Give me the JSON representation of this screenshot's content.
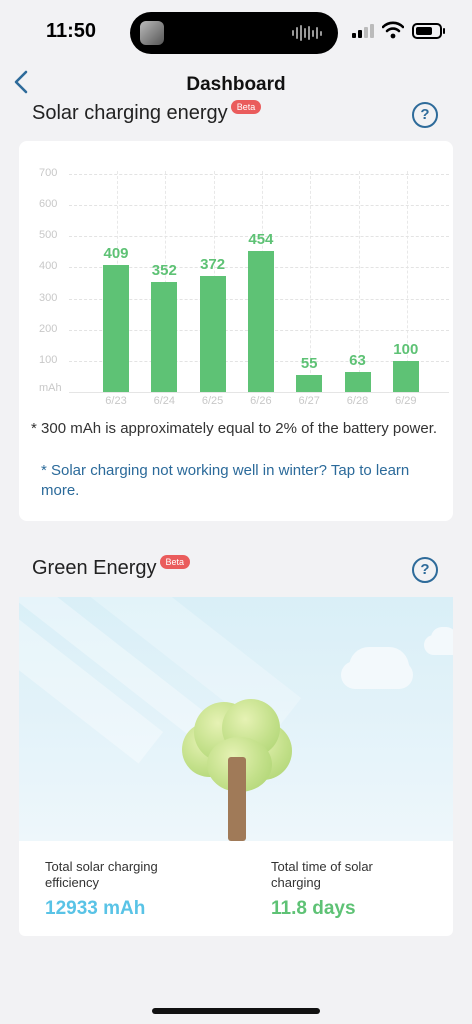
{
  "status_bar": {
    "time": "11:50"
  },
  "nav": {
    "title": "Dashboard"
  },
  "solar": {
    "title": "Solar charging energy",
    "beta": "Beta",
    "help": "?",
    "note": "* 300 mAh is approximately equal to 2% of the battery power.",
    "link": "* Solar charging not working well in winter? Tap to learn more."
  },
  "chart_data": {
    "type": "bar",
    "categories": [
      "6/23",
      "6/24",
      "6/25",
      "6/26",
      "6/27",
      "6/28",
      "6/29"
    ],
    "values": [
      409,
      352,
      372,
      454,
      55,
      63,
      100
    ],
    "ylim": [
      0,
      700
    ],
    "yticks": [
      "mAh",
      "100",
      "200",
      "300",
      "400",
      "500",
      "600",
      "700"
    ],
    "bar_color": "#5ec275",
    "grid": true
  },
  "green": {
    "title": "Green Energy",
    "beta": "Beta",
    "help": "?",
    "efficiency_label": "Total solar charging efficiency",
    "efficiency_value": "12933 mAh",
    "efficiency_color": "#59c3e6",
    "time_label": "Total time of solar charging",
    "time_value": "11.8 days",
    "time_color": "#5ec275"
  }
}
